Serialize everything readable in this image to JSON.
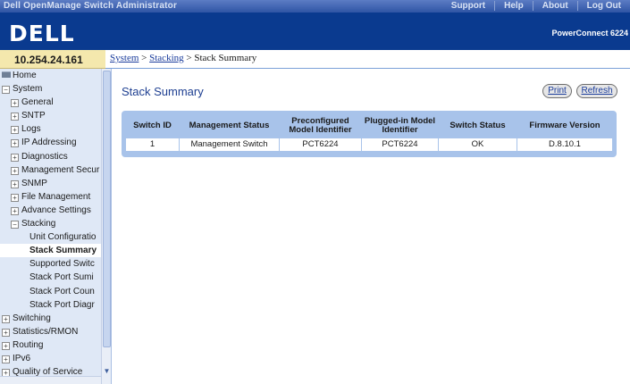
{
  "top": {
    "title": "Dell OpenManage Switch Administrator",
    "links": [
      "Support",
      "Help",
      "About",
      "Log Out"
    ]
  },
  "banner": {
    "logo": "DELL",
    "product": "PowerConnect 6224"
  },
  "ip": "10.254.24.161",
  "breadcrumb": {
    "items": [
      "System",
      "Stacking"
    ],
    "separator": " > ",
    "current": "Stack Summary"
  },
  "sidebar": {
    "items": [
      {
        "label": "Home",
        "level": 0,
        "icon": "folder-icon"
      },
      {
        "label": "System",
        "level": 0,
        "toggle": "−"
      },
      {
        "label": "General",
        "level": 1,
        "toggle": "+"
      },
      {
        "label": "SNTP",
        "level": 1,
        "toggle": "+"
      },
      {
        "label": "Logs",
        "level": 1,
        "toggle": "+"
      },
      {
        "label": "IP Addressing",
        "level": 1,
        "toggle": "+"
      },
      {
        "label": "Diagnostics",
        "level": 1,
        "toggle": "+"
      },
      {
        "label": "Management Secur",
        "level": 1,
        "toggle": "+"
      },
      {
        "label": "SNMP",
        "level": 1,
        "toggle": "+"
      },
      {
        "label": "File Management",
        "level": 1,
        "toggle": "+"
      },
      {
        "label": "Advance Settings",
        "level": 1,
        "toggle": "+"
      },
      {
        "label": "Stacking",
        "level": 1,
        "toggle": "−"
      },
      {
        "label": "Unit Configuratio",
        "level": 2
      },
      {
        "label": "Stack Summary",
        "level": 2,
        "selected": true
      },
      {
        "label": "Supported Switc",
        "level": 2
      },
      {
        "label": "Stack Port Sumi",
        "level": 2
      },
      {
        "label": "Stack Port Coun",
        "level": 2
      },
      {
        "label": "Stack Port Diagr",
        "level": 2
      },
      {
        "label": "Switching",
        "level": 0,
        "toggle": "+"
      },
      {
        "label": "Statistics/RMON",
        "level": 0,
        "toggle": "+"
      },
      {
        "label": "Routing",
        "level": 0,
        "toggle": "+"
      },
      {
        "label": "IPv6",
        "level": 0,
        "toggle": "+"
      },
      {
        "label": "Quality of Service",
        "level": 0,
        "toggle": "+"
      }
    ]
  },
  "main": {
    "title": "Stack Summary",
    "print_label": "Print",
    "refresh_label": "Refresh",
    "table": {
      "headers": [
        "Switch ID",
        "Management Status",
        "Preconfigured Model Identifier",
        "Plugged-in Model Identifier",
        "Switch Status",
        "Firmware Version"
      ],
      "rows": [
        [
          "1",
          "Management Switch",
          "PCT6224",
          "PCT6224",
          "OK",
          "D.8.10.1"
        ]
      ]
    }
  },
  "colors": {
    "banner": "#0a3a8f",
    "sidebar": "#dfe8f6",
    "ip_box": "#f4e8ad",
    "table_frame": "#a8c3ea",
    "title": "#1e3f91"
  }
}
